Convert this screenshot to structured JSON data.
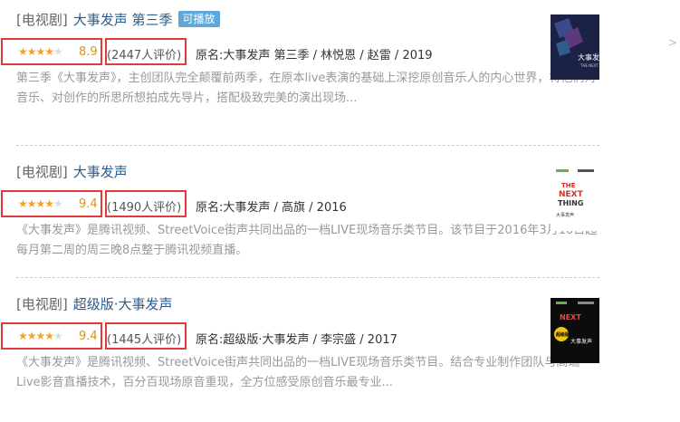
{
  "results": [
    {
      "type": "[电视剧]",
      "title": "大事发声 第三季",
      "badge": "可播放",
      "rating": 4.5,
      "score": "8.9",
      "votes": "(2447人评价)",
      "abstract": "原名:大事发声 第三季 / 林悦恩 / 赵雷 / 2019",
      "desc": "第三季《大事发声》，主创团队完全颠覆前两季，在原本live表演的基础上深挖原创音乐人的内心世界，将他们对音乐、对创作的所思所想拍成先导片，搭配极致完美的演出现场..."
    },
    {
      "type": "[电视剧]",
      "title": "大事发声",
      "badge": "",
      "rating": 4.5,
      "score": "9.4",
      "votes": "(1490人评价)",
      "abstract": "原名:大事发声 / 高旗 / 2016",
      "desc": "《大事发声》是腾讯视频、StreetVoice街声共同出品的一档LIVE现场音乐类节目。该节目于2016年3月16日起每月第二周的周三晚8点整于腾讯视频直播。"
    },
    {
      "type": "[电视剧]",
      "title": "超级版·大事发声",
      "badge": "",
      "rating": 4.5,
      "score": "9.4",
      "votes": "(1445人评价)",
      "abstract": "原名:超级版·大事发声 / 李宗盛 / 2017",
      "desc": "《大事发声》是腾讯视频、StreetVoice街声共同出品的一档LIVE现场音乐类节目。结合专业制作团队与高端Live影音直播技术，百分百现场原音重现，全方位感受原创音乐最专业..."
    }
  ],
  "colors": {
    "title_link": "#2d5c8a",
    "star": "#f3a22a",
    "highlight_box": "#e03b3b",
    "badge_bg": "#5fa8d8"
  },
  "icons": {
    "chevron": "chevron-right-icon"
  },
  "posters": [
    {
      "text": "大事发声"
    },
    {
      "text": "大事发声"
    },
    {
      "text": "超级版"
    }
  ]
}
